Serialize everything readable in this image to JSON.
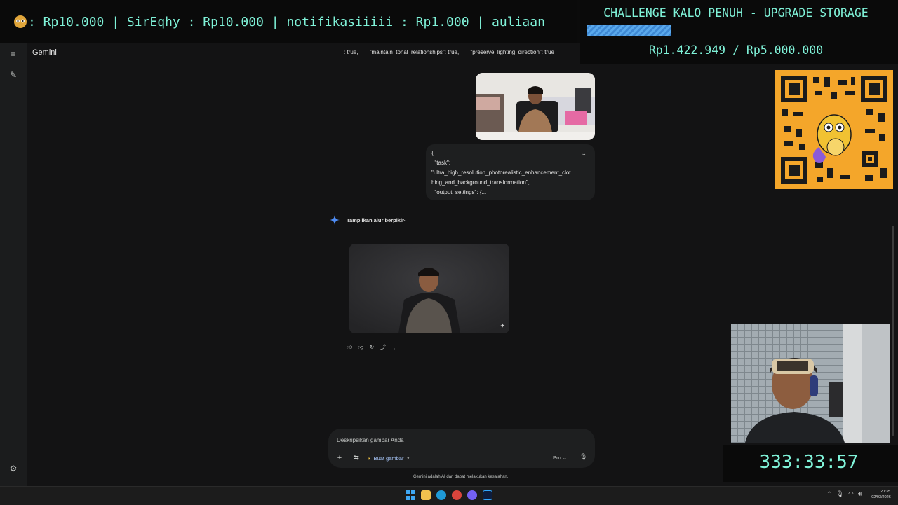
{
  "ticker": {
    "text": ": Rp10.000 | SirEqhy  : Rp10.000 | notifikasiiiii  : Rp1.000 | auliaan"
  },
  "challenge": {
    "title": "CHALLENGE KALO PENUH - UPGRADE STORAGE",
    "amount": "Rp1.422.949 / Rp5.000.000",
    "progress_fraction": 0.2846
  },
  "timer": {
    "value": "333:33:57"
  },
  "app": {
    "title": "Gemini",
    "top_strip": [
      ": true,",
      "\"maintain_tonal_relationships\": true,",
      "\"preserve_lighting_direction\": true"
    ],
    "prompt_lines": [
      "{",
      "  \"task\":",
      "\"ultra_high_resolution_photorealistic_enhancement_clot",
      "hing_and_background_transformation\",",
      "  \"output_settings\": {..."
    ],
    "thinking_label": "Tampilkan alur berpikir",
    "input_placeholder": "Deskripsikan gambar Anda",
    "chip_label": "Buat gambar",
    "chip_close": "×",
    "model": "Pro",
    "disclaimer": "Gemini adalah AI dan dapat melakukan kesalahan."
  },
  "taskbar": {
    "time": "20:35",
    "date": "02/03/2026"
  },
  "colors": {
    "accent_text": "#7ff2d8",
    "qr_background": "#f4a62a",
    "progress": "#4a96e0"
  },
  "icons": [
    "menu-icon",
    "edit-icon",
    "settings-icon",
    "sparkle-icon",
    "thumbs-up-icon",
    "thumbs-down-icon",
    "refresh-icon",
    "share-icon",
    "more-icon",
    "plus-icon",
    "tools-icon",
    "banana-icon",
    "mic-icon"
  ]
}
